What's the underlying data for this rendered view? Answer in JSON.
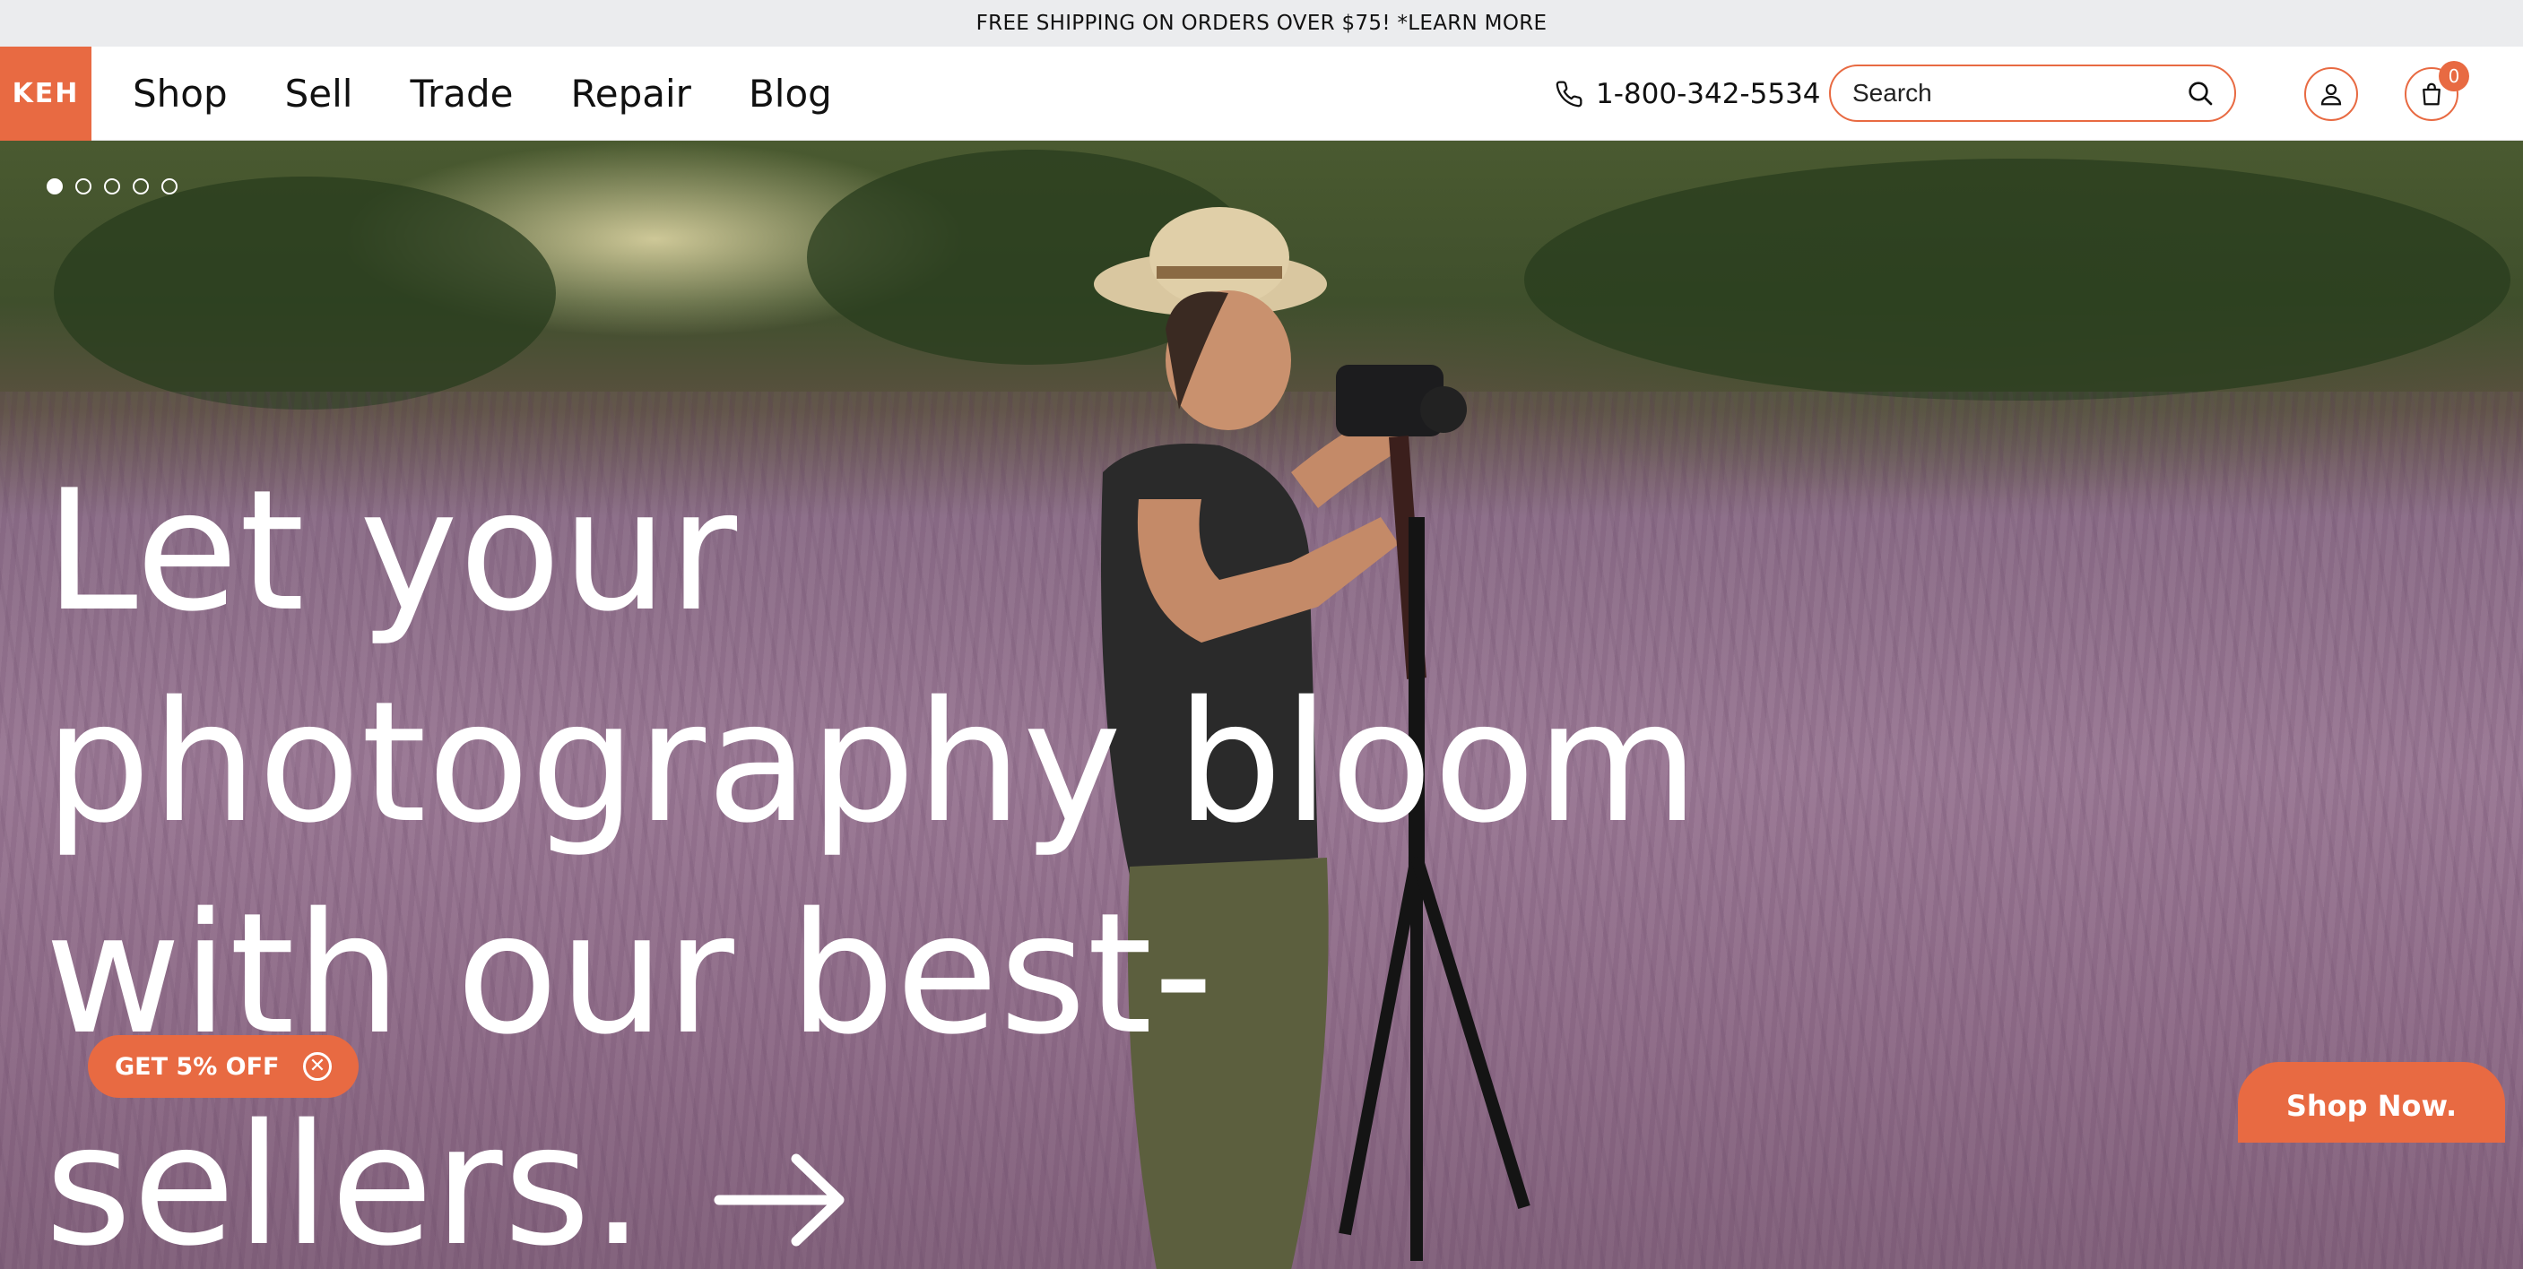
{
  "announcement": {
    "text": "FREE SHIPPING ON ORDERS OVER $75! *LEARN MORE"
  },
  "header": {
    "logo": "KEH",
    "nav": [
      {
        "label": "Shop"
      },
      {
        "label": "Sell"
      },
      {
        "label": "Trade"
      },
      {
        "label": "Repair"
      },
      {
        "label": "Blog"
      }
    ],
    "phone": "1-800-342-5534",
    "search": {
      "placeholder": "Search",
      "value": ""
    },
    "cart_count": "0",
    "icons": {
      "phone": "phone-icon",
      "search": "search-icon",
      "account": "user-icon",
      "cart": "shopping-bag-icon"
    }
  },
  "hero": {
    "slides_total": 5,
    "active_slide": 1,
    "headline_lines": [
      "Let your",
      "photography bloom",
      "with our best-",
      "sellers."
    ],
    "arrow_icon": "arrow-right-icon",
    "cta_label": "Shop Now."
  },
  "promo": {
    "label": "GET 5% OFF",
    "close_icon": "close-circle-icon"
  },
  "colors": {
    "accent": "#e86a42",
    "announcement_bg": "#ebecee",
    "text_dark": "#111111",
    "hero_text": "#ffffff"
  }
}
